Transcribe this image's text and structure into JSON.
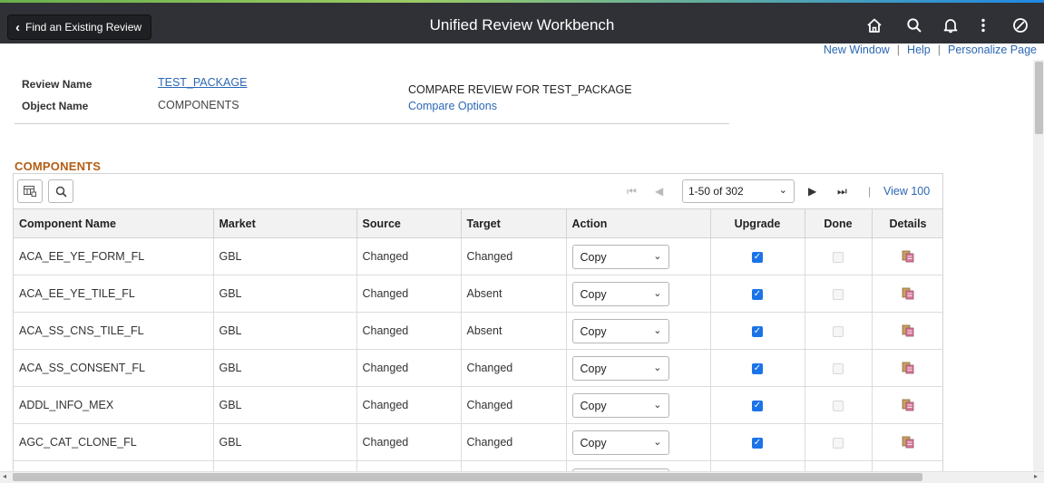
{
  "header": {
    "back_label": "Find an Existing Review",
    "title": "Unified Review Workbench",
    "icons": [
      "home-icon",
      "search-icon",
      "bell-icon",
      "more-vertical-icon",
      "navbar-compass-icon"
    ]
  },
  "links": {
    "new_window": "New Window",
    "help": "Help",
    "personalize": "Personalize Page"
  },
  "summary": {
    "review_name_label": "Review Name",
    "review_name_value": "TEST_PACKAGE",
    "object_name_label": "Object Name",
    "object_name_value": "COMPONENTS",
    "compare_title": "COMPARE REVIEW FOR TEST_PACKAGE",
    "compare_options": "Compare Options"
  },
  "grid": {
    "title": "COMPONENTS",
    "pager": {
      "range": "1-50 of 302",
      "view_all": "View 100"
    },
    "columns": [
      "Component Name",
      "Market",
      "Source",
      "Target",
      "Action",
      "Upgrade",
      "Done",
      "Details"
    ],
    "rows": [
      {
        "name": "ACA_EE_YE_FORM_FL",
        "market": "GBL",
        "source": "Changed",
        "target": "Changed",
        "action": "Copy",
        "upgrade": true,
        "done": false
      },
      {
        "name": "ACA_EE_YE_TILE_FL",
        "market": "GBL",
        "source": "Changed",
        "target": "Absent",
        "action": "Copy",
        "upgrade": true,
        "done": false
      },
      {
        "name": "ACA_SS_CNS_TILE_FL",
        "market": "GBL",
        "source": "Changed",
        "target": "Absent",
        "action": "Copy",
        "upgrade": true,
        "done": false
      },
      {
        "name": "ACA_SS_CONSENT_FL",
        "market": "GBL",
        "source": "Changed",
        "target": "Changed",
        "action": "Copy",
        "upgrade": true,
        "done": false
      },
      {
        "name": "ADDL_INFO_MEX",
        "market": "GBL",
        "source": "Changed",
        "target": "Changed",
        "action": "Copy",
        "upgrade": true,
        "done": false
      },
      {
        "name": "AGC_CAT_CLONE_FL",
        "market": "GBL",
        "source": "Changed",
        "target": "Changed",
        "action": "Copy",
        "upgrade": true,
        "done": false
      }
    ]
  },
  "colors": {
    "header_bg": "#2f3136",
    "link": "#2c67b5",
    "section_title": "#b55d14",
    "checkbox_on": "#1b73e8"
  }
}
